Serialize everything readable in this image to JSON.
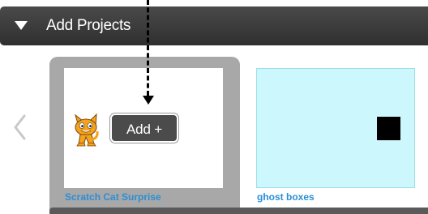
{
  "header": {
    "title": "Add Projects",
    "toggle_icon": "triangle-down-icon"
  },
  "carousel": {
    "prev_icon": "chevron-left-icon",
    "projects": [
      {
        "title": "Scratch Cat Surprise",
        "selected": true,
        "add_label": "Add +",
        "thumbnail_icon": "scratch-cat-icon"
      },
      {
        "title": "ghost boxes",
        "selected": false,
        "thumbnail_color": "#ccf8fd",
        "thumbnail_icon": "black-square-icon"
      }
    ]
  },
  "colors": {
    "header_background": "#3a3a3a",
    "selected_card_background": "#a8a8a8",
    "project_title": "#2a8fd6",
    "add_button_background": "#4b4b4b"
  }
}
